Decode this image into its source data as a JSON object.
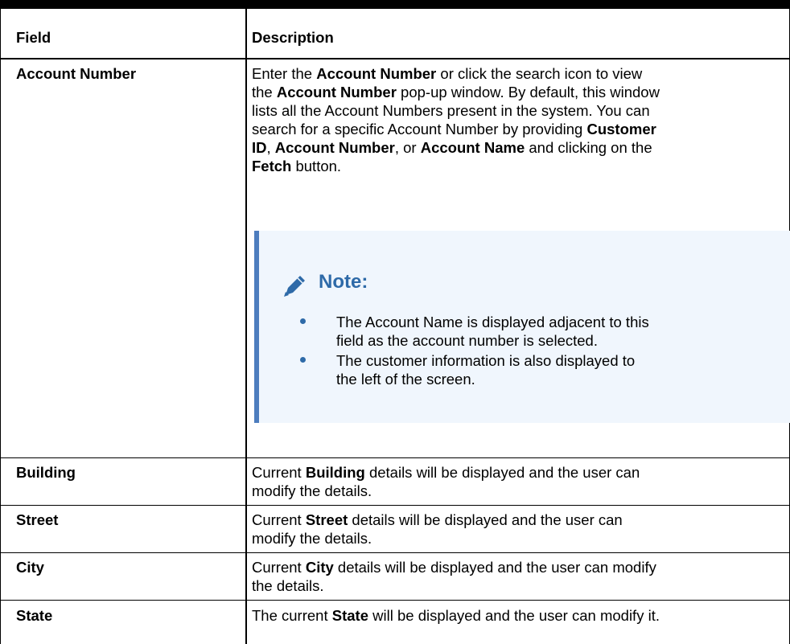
{
  "table": {
    "header": {
      "field": "Field",
      "description": "Description"
    },
    "rows": {
      "account_number": {
        "field": "Account Number",
        "desc": {
          "l1a": "Enter the ",
          "l1b": "Account Number",
          "l1c": " or click the search icon to view",
          "l2a": "the ",
          "l2b": "Account Number",
          "l2c": " pop-up window. By default, this window",
          "l3": "lists all the Account Numbers present in the system. You can",
          "l4a": "search for a specific Account Number by providing ",
          "l4b": "Customer",
          "l5a": "ID",
          "l5b": ", ",
          "l5c": "Account Number",
          "l5d": ", or ",
          "l5e": "Account Name",
          "l5f": " and clicking on the",
          "l6a": "Fetch",
          "l6b": " button."
        },
        "note": {
          "title": "Note:",
          "icon": "pencil-icon",
          "accent_color": "#2e6aa8",
          "items": [
            {
              "line1": "The Account Name is displayed adjacent to this",
              "line2": "field as the account number is selected."
            },
            {
              "line1": "The customer information is also displayed to",
              "line2": "the left of the screen."
            }
          ]
        }
      },
      "building": {
        "field": "Building",
        "l1a": "Current ",
        "l1b": "Building",
        "l1c": " details will be displayed and the user can",
        "l2": "modify the details."
      },
      "street": {
        "field": "Street",
        "l1a": "Current ",
        "l1b": "Street",
        "l1c": " details will be displayed and the user can",
        "l2": "modify the details."
      },
      "city": {
        "field": "City",
        "l1a": "Current ",
        "l1b": "City",
        "l1c": " details will be displayed and the user can modify",
        "l2": "the details."
      },
      "state": {
        "field": "State",
        "l1a": "The current ",
        "l1b": "State",
        "l1c": " will be displayed and the user can modify it."
      }
    }
  }
}
